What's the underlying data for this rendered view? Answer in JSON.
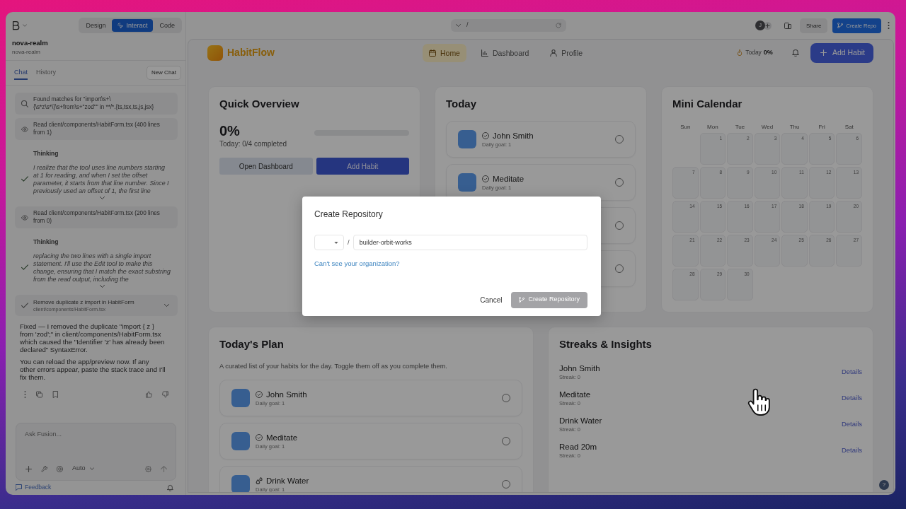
{
  "sidebar": {
    "project": {
      "name": "nova-realm",
      "subtitle": "nova-realm"
    },
    "modes": [
      {
        "label": "Design",
        "selected": false
      },
      {
        "label": "Interact",
        "selected": true
      },
      {
        "label": "Code",
        "selected": false
      }
    ],
    "tabs": [
      {
        "label": "Chat",
        "selected": true
      },
      {
        "label": "History",
        "selected": false
      }
    ],
    "new_chat": "New Chat",
    "messages": [
      {
        "kind": "search",
        "text": "Found matches for \"import\\s+\\{\\s*z\\s*\\}\\s+from\\s+\"zod\"\" in **/*.{ts,tsx,ts,js,jsx}"
      },
      {
        "kind": "read",
        "text": "Read client/components/HabitForm.tsx (400 lines from 1)"
      },
      {
        "kind": "thinking",
        "label": "Thinking",
        "text": "I realize that the tool uses line numbers starting at 1 for reading, and when I set the offset parameter, it starts from that line number. Since I previously used an offset of 1, the first line"
      },
      {
        "kind": "read",
        "text": "Read client/components/HabitForm.tsx (200 lines from 0)"
      },
      {
        "kind": "thinking",
        "label": "Thinking",
        "text": "replacing the two lines with a single import statement. I'll use the Edit tool to make this change, ensuring that I match the exact substring from the read output, including the"
      },
      {
        "kind": "edit",
        "title": "Remove duplicate z import in HabitForm",
        "file": "client/components/HabitForm.tsx"
      },
      {
        "kind": "reply",
        "paragraphs": [
          "Fixed — I removed the duplicate \"import { z } from 'zod';\" in client/components/HabitForm.tsx which caused the \"Identifier 'z' has already been declared\" SyntaxError.",
          "You can reload the app/preview now. If any other errors appear, paste the stack trace and I'll fix them."
        ]
      }
    ],
    "composer": {
      "placeholder": "Ask Fusion...",
      "mode": "Auto"
    },
    "feedback": "Feedback"
  },
  "toolbar": {
    "path": "/",
    "avatar": "J",
    "share": "Share",
    "create_repo": "Create Repo"
  },
  "app": {
    "brand": "HabitFlow",
    "nav": [
      {
        "kind": "home",
        "label": "Home",
        "selected": true
      },
      {
        "kind": "dashboard",
        "label": "Dashboard",
        "selected": false
      },
      {
        "kind": "profile",
        "label": "Profile",
        "selected": false
      }
    ],
    "today_label": "Today",
    "today_value": "0%",
    "add_habit": "Add Habit",
    "quick_overview": {
      "title": "Quick Overview",
      "percent": "0%",
      "level": 0,
      "summary": "Today: 0/4 completed",
      "buttons": [
        {
          "kind": "secondary",
          "label": "Open Dashboard"
        },
        {
          "kind": "primary",
          "label": "Add Habit"
        }
      ]
    },
    "today": {
      "title": "Today",
      "items": [
        {
          "kind": "check",
          "name": "John Smith",
          "goal": "Daily goal: 1",
          "checked": false
        },
        {
          "kind": "check",
          "name": "Meditate",
          "goal": "Daily goal: 1",
          "checked": false
        },
        {
          "checked": false
        },
        {
          "checked": false
        }
      ]
    },
    "calendar": {
      "title": "Mini Calendar",
      "weekdays": [
        "Sun",
        "Mon",
        "Tue",
        "Wed",
        "Thu",
        "Fri",
        "Sat"
      ],
      "weeks": [
        [
          "1",
          "2",
          "3",
          "4",
          "5",
          "6"
        ],
        [
          "7",
          "8",
          "9",
          "10",
          "11",
          "12",
          "13"
        ],
        [
          "14",
          "15",
          "16",
          "17",
          "18",
          "19",
          "20"
        ],
        [
          "21",
          "22",
          "23",
          "24",
          "25",
          "26",
          "27"
        ],
        [
          "28",
          "29",
          "30"
        ]
      ]
    },
    "plan": {
      "title": "Today's Plan",
      "description": "A curated list of your habits for the day. Toggle them off as you complete them.",
      "items": [
        {
          "kind": "check",
          "name": "John Smith",
          "goal": "Daily goal: 1",
          "checked": false
        },
        {
          "kind": "check",
          "name": "Meditate",
          "goal": "Daily goal: 1",
          "checked": false
        },
        {
          "kind": "water",
          "name": "Drink Water",
          "goal": "Daily goal: 1",
          "checked": false
        }
      ]
    },
    "streaks": {
      "title": "Streaks & Insights",
      "items": [
        {
          "name": "John Smith",
          "streak": "Streak: 0",
          "action": "Details"
        },
        {
          "name": "Meditate",
          "streak": "Streak: 0",
          "action": "Details"
        },
        {
          "name": "Drink Water",
          "streak": "Streak: 0",
          "action": "Details"
        },
        {
          "name": "Read 20m",
          "streak": "Streak: 0",
          "action": "Details"
        }
      ]
    }
  },
  "modal": {
    "title": "Create Repository",
    "separator": "/",
    "repo_name": "builder-orbit-works",
    "help_link": "Can't see your organization?",
    "cancel": "Cancel",
    "submit": {
      "label": "Create Repository",
      "disabled": true
    }
  },
  "help": "?"
}
